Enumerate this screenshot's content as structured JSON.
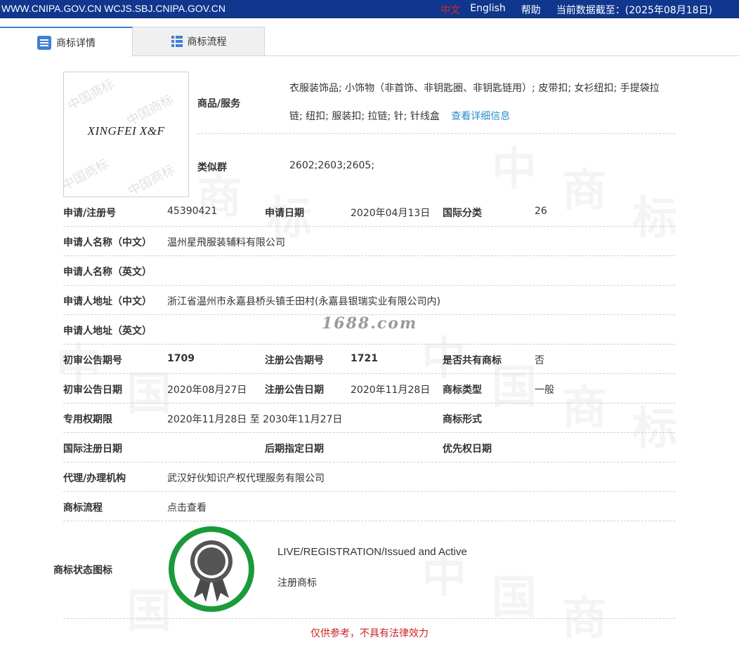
{
  "topbar": {
    "site_urls": "WWW.CNIPA.GOV.CN WCJS.SBJ.CNIPA.GOV.CN",
    "lang_cn": "中文",
    "lang_en": "English",
    "help": "帮助",
    "data_cutoff": "当前数据截至：(2025年08月18日)"
  },
  "tabs": [
    {
      "label": "商标详情",
      "icon": "document-list-icon",
      "active": true
    },
    {
      "label": "商标流程",
      "icon": "grid-list-icon",
      "active": false
    }
  ],
  "trademark": {
    "logo_text": "XINGFEI  X&F",
    "logo_watermark": "中国商标",
    "goods_label": "商品/服务",
    "goods_line1": "衣服装饰品; 小饰物（非首饰、非钥匙圈、非钥匙链用）; 皮带扣; 女衫纽扣; 手提袋拉",
    "goods_line2": "链; 纽扣; 服装扣; 拉链; 针; 针线盒",
    "goods_detail_link": "查看详细信息",
    "similar_group_label": "类似群",
    "similar_group_value": "2602;2603;2605;"
  },
  "fields": {
    "reg_no_label": "申请/注册号",
    "reg_no": "45390421",
    "apply_date_label": "申请日期",
    "apply_date": "2020年04月13日",
    "intl_class_label": "国际分类",
    "intl_class": "26",
    "applicant_cn_label": "申请人名称（中文）",
    "applicant_cn": "温州星飛服装辅料有限公司",
    "applicant_en_label": "申请人名称（英文）",
    "applicant_en": "",
    "address_cn_label": "申请人地址（中文）",
    "address_cn": "浙江省温州市永嘉县桥头镇壬田村(永嘉县银瑞实业有限公司内)",
    "address_en_label": "申请人地址（英文）",
    "address_en": "",
    "prelim_issue_label": "初审公告期号",
    "prelim_issue": "1709",
    "reg_issue_label": "注册公告期号",
    "reg_issue": "1721",
    "shared_label": "是否共有商标",
    "shared": "否",
    "prelim_date_label": "初审公告日期",
    "prelim_date": "2020年08月27日",
    "reg_date_label": "注册公告日期",
    "reg_date": "2020年11月28日",
    "tm_type_label": "商标类型",
    "tm_type": "一般",
    "exclusive_label": "专用权期限",
    "exclusive": "2020年11月28日 至 2030年11月27日",
    "tm_form_label": "商标形式",
    "tm_form": "",
    "intl_reg_date_label": "国际注册日期",
    "intl_reg_date": "",
    "later_designation_label": "后期指定日期",
    "later_designation": "",
    "priority_date_label": "优先权日期",
    "priority_date": "",
    "agent_label": "代理/办理机构",
    "agent": "武汉好伙知识产权代理服务有限公司",
    "process_label": "商标流程",
    "process_link": "点击查看",
    "status_label": "商标状态图标",
    "status_en": "LIVE/REGISTRATION/Issued and Active",
    "status_cn": "注册商标"
  },
  "site_watermark": "1688.com",
  "disclaimer": "仅供参考，不具有法律效力",
  "colors": {
    "topbar_bg": "#10378d",
    "active_lang": "#e02828",
    "link": "#2a8ec8",
    "badge_ring": "#1a9a3a",
    "disclaimer": "#cc2222"
  }
}
